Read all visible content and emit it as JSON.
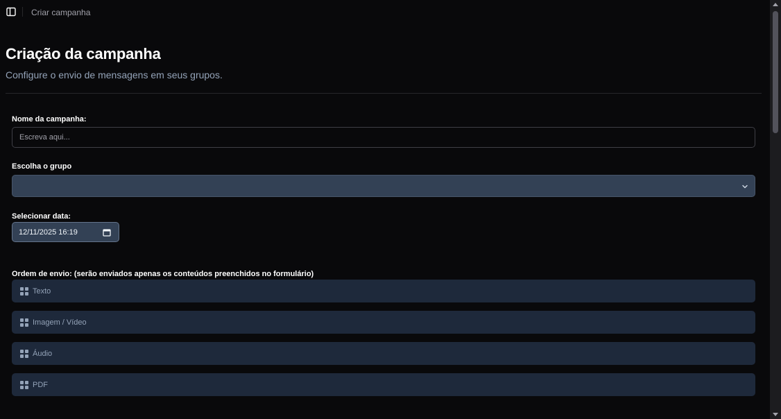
{
  "breadcrumb": {
    "current": "Criar campanha"
  },
  "header": {
    "title": "Criação da campanha",
    "subtitle": "Configure o envio de mensagens em seus grupos."
  },
  "form": {
    "campaign_name": {
      "label": "Nome da campanha:",
      "value": "",
      "placeholder": "Escreva aqui..."
    },
    "group": {
      "label": "Escolha o grupo",
      "selected": ""
    },
    "date": {
      "label": "Selecionar data:",
      "value": "12/11/2025 16:19"
    },
    "order": {
      "label": "Ordem de envio: (serão enviados apenas os conteúdos preenchidos no formulário)",
      "items": [
        {
          "label": "Texto"
        },
        {
          "label": "Imagem / Vídeo"
        },
        {
          "label": "Áudio"
        },
        {
          "label": "PDF"
        }
      ]
    }
  },
  "icons": {
    "sidebar_toggle": "panel-left-icon",
    "select": "chevron-down-icon",
    "date": "calendar-icon",
    "drag": "grip-icon"
  },
  "colors": {
    "background": "#09090b",
    "select_bg": "#334155",
    "item_bg": "#1e293b",
    "muted_text": "#94a3b8"
  }
}
